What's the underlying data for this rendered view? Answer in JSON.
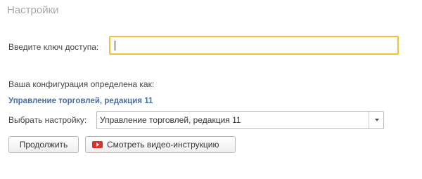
{
  "header": {
    "title": "Настройки"
  },
  "access_key": {
    "label": "Введите ключ доступа:",
    "value": ""
  },
  "configuration": {
    "label": "Ваша конфигурация определена как:",
    "detected": "Управление торговлей, редакция 11"
  },
  "setting_select": {
    "label": "Выбрать настройку:",
    "selected": "Управление торговлей, редакция 11"
  },
  "buttons": {
    "continue_label": "Продолжить",
    "video_label": "Смотреть видео-инструкцию"
  },
  "icons": {
    "video": "youtube-play-icon",
    "dropdown": "chevron-down-icon"
  },
  "colors": {
    "input_focus_border": "#f2c232",
    "config_link": "#4a6ea8",
    "youtube_red": "#d9312b"
  }
}
